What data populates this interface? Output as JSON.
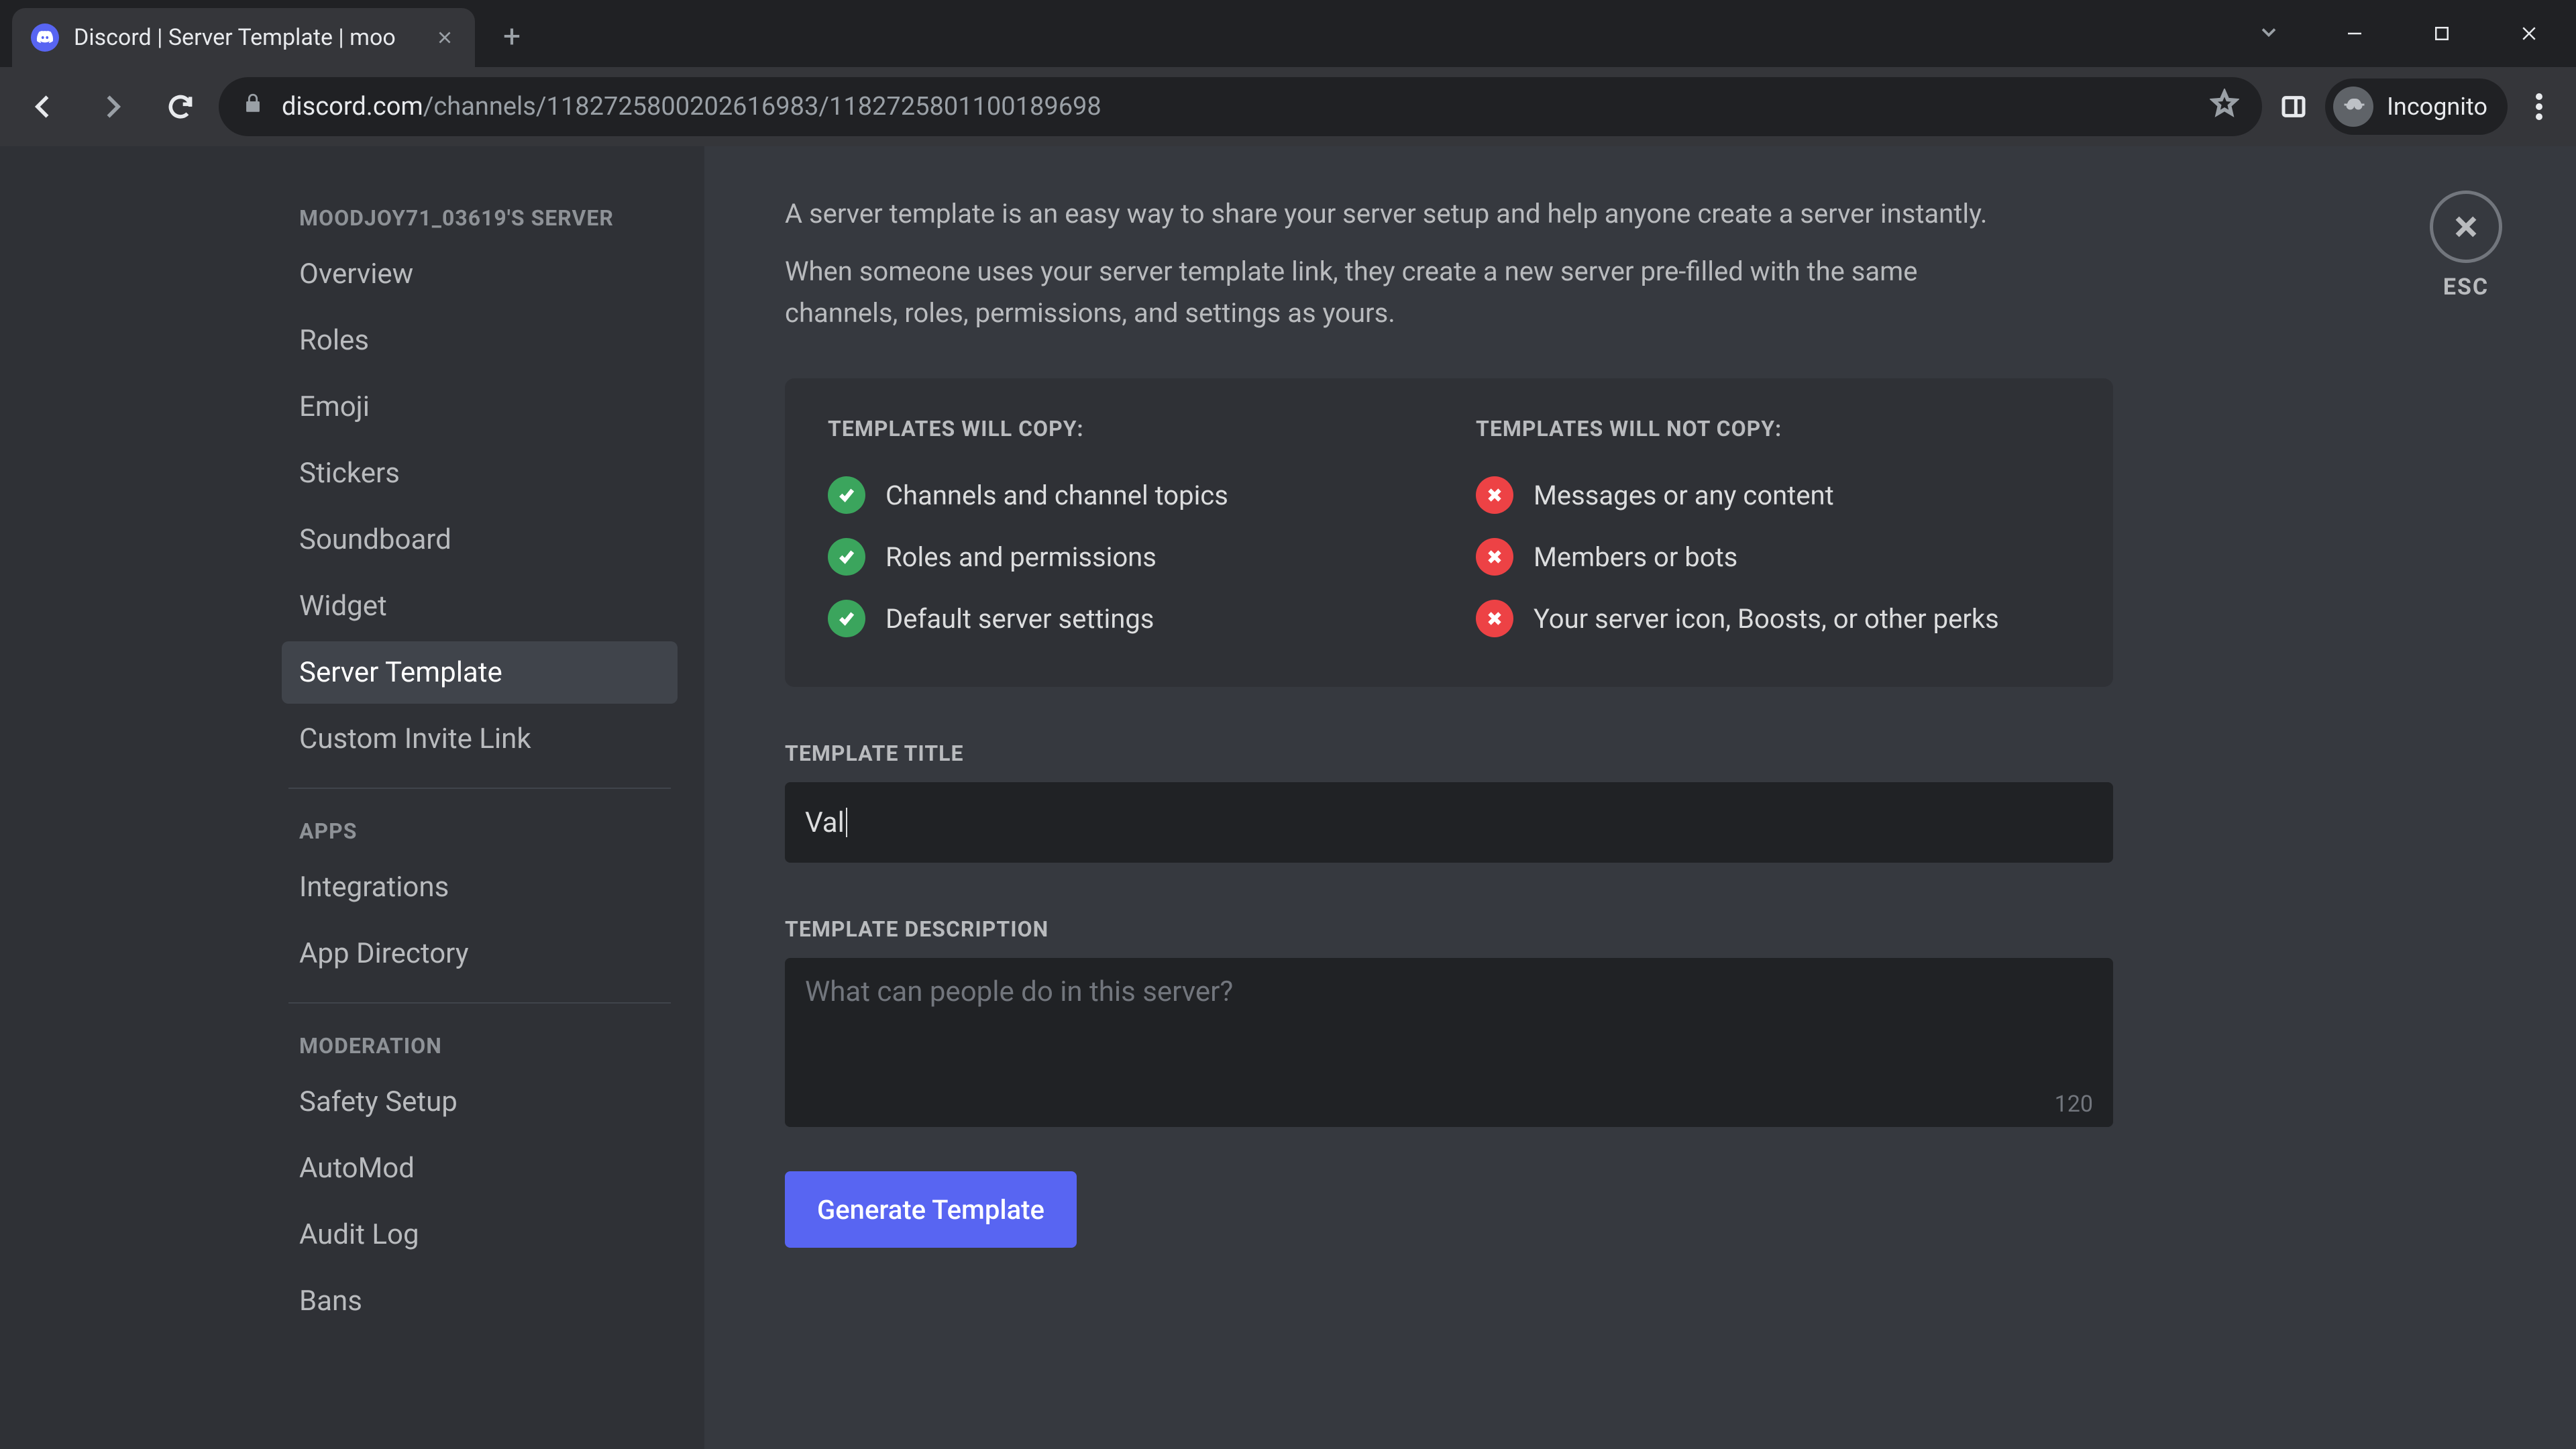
{
  "browser": {
    "tab_title": "Discord | Server Template | moo",
    "url_host": "discord.com",
    "url_path": "/channels/1182725800202616983/1182725801100189698",
    "profile_label": "Incognito"
  },
  "sidebar": {
    "server_name": "MOODJOY71_03619'S SERVER",
    "items_general": [
      {
        "label": "Overview"
      },
      {
        "label": "Roles"
      },
      {
        "label": "Emoji"
      },
      {
        "label": "Stickers"
      },
      {
        "label": "Soundboard"
      },
      {
        "label": "Widget"
      },
      {
        "label": "Server Template"
      },
      {
        "label": "Custom Invite Link"
      }
    ],
    "section_apps": "APPS",
    "items_apps": [
      {
        "label": "Integrations"
      },
      {
        "label": "App Directory"
      }
    ],
    "section_moderation": "MODERATION",
    "items_moderation": [
      {
        "label": "Safety Setup"
      },
      {
        "label": "AutoMod"
      },
      {
        "label": "Audit Log"
      },
      {
        "label": "Bans"
      }
    ]
  },
  "content": {
    "intro1": "A server template is an easy way to share your server setup and help anyone create a server instantly.",
    "intro2": "When someone uses your server template link, they create a new server pre-filled with the same channels, roles, permissions, and settings as yours.",
    "will_copy_title": "TEMPLATES WILL COPY:",
    "will_copy": [
      "Channels and channel topics",
      "Roles and permissions",
      "Default server settings"
    ],
    "wont_copy_title": "TEMPLATES WILL NOT COPY:",
    "wont_copy": [
      "Messages or any content",
      "Members or bots",
      "Your server icon, Boosts, or other perks"
    ],
    "title_label": "TEMPLATE TITLE",
    "title_value": "Val",
    "desc_label": "TEMPLATE DESCRIPTION",
    "desc_placeholder": "What can people do in this server?",
    "desc_counter": "120",
    "generate_label": "Generate Template",
    "esc_label": "ESC"
  }
}
